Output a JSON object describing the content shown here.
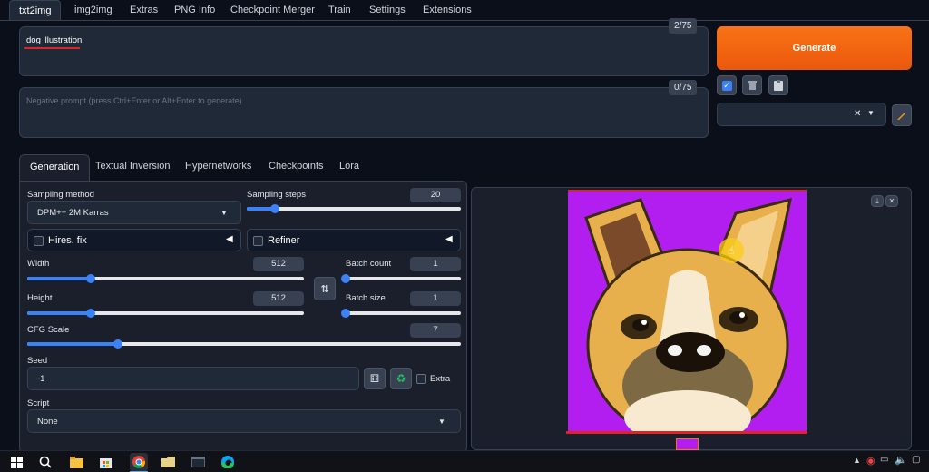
{
  "top_tabs": [
    "txt2img",
    "img2img",
    "Extras",
    "PNG Info",
    "Checkpoint Merger",
    "Train",
    "Settings",
    "Extensions"
  ],
  "prompt": {
    "value": "dog illustration",
    "counter": "2/75"
  },
  "negative_prompt": {
    "placeholder": "Negative prompt (press Ctrl+Enter or Alt+Enter to generate)",
    "counter": "0/75"
  },
  "generate_label": "Generate",
  "sub_tabs": [
    "Generation",
    "Textual Inversion",
    "Hypernetworks",
    "Checkpoints",
    "Lora"
  ],
  "sampling_method": {
    "label": "Sampling method",
    "value": "DPM++ 2M Karras"
  },
  "sampling_steps": {
    "label": "Sampling steps",
    "value": "20",
    "fraction": 0.13
  },
  "hires_fix": {
    "label": "Hires. fix"
  },
  "refiner": {
    "label": "Refiner"
  },
  "width": {
    "label": "Width",
    "value": "512",
    "fraction": 0.23
  },
  "height": {
    "label": "Height",
    "value": "512",
    "fraction": 0.23
  },
  "batch_count": {
    "label": "Batch count",
    "value": "1",
    "fraction": 0.0
  },
  "batch_size": {
    "label": "Batch size",
    "value": "1",
    "fraction": 0.0
  },
  "cfg_scale": {
    "label": "CFG Scale",
    "value": "7",
    "fraction": 0.21
  },
  "seed": {
    "label": "Seed",
    "value": "-1",
    "extra_label": "Extra"
  },
  "script": {
    "label": "Script",
    "value": "None"
  },
  "colors": {
    "accent": "#3b82f6",
    "generate": "#f97316",
    "image_bg": "#b21ef0",
    "image_border": "#dc2626"
  }
}
